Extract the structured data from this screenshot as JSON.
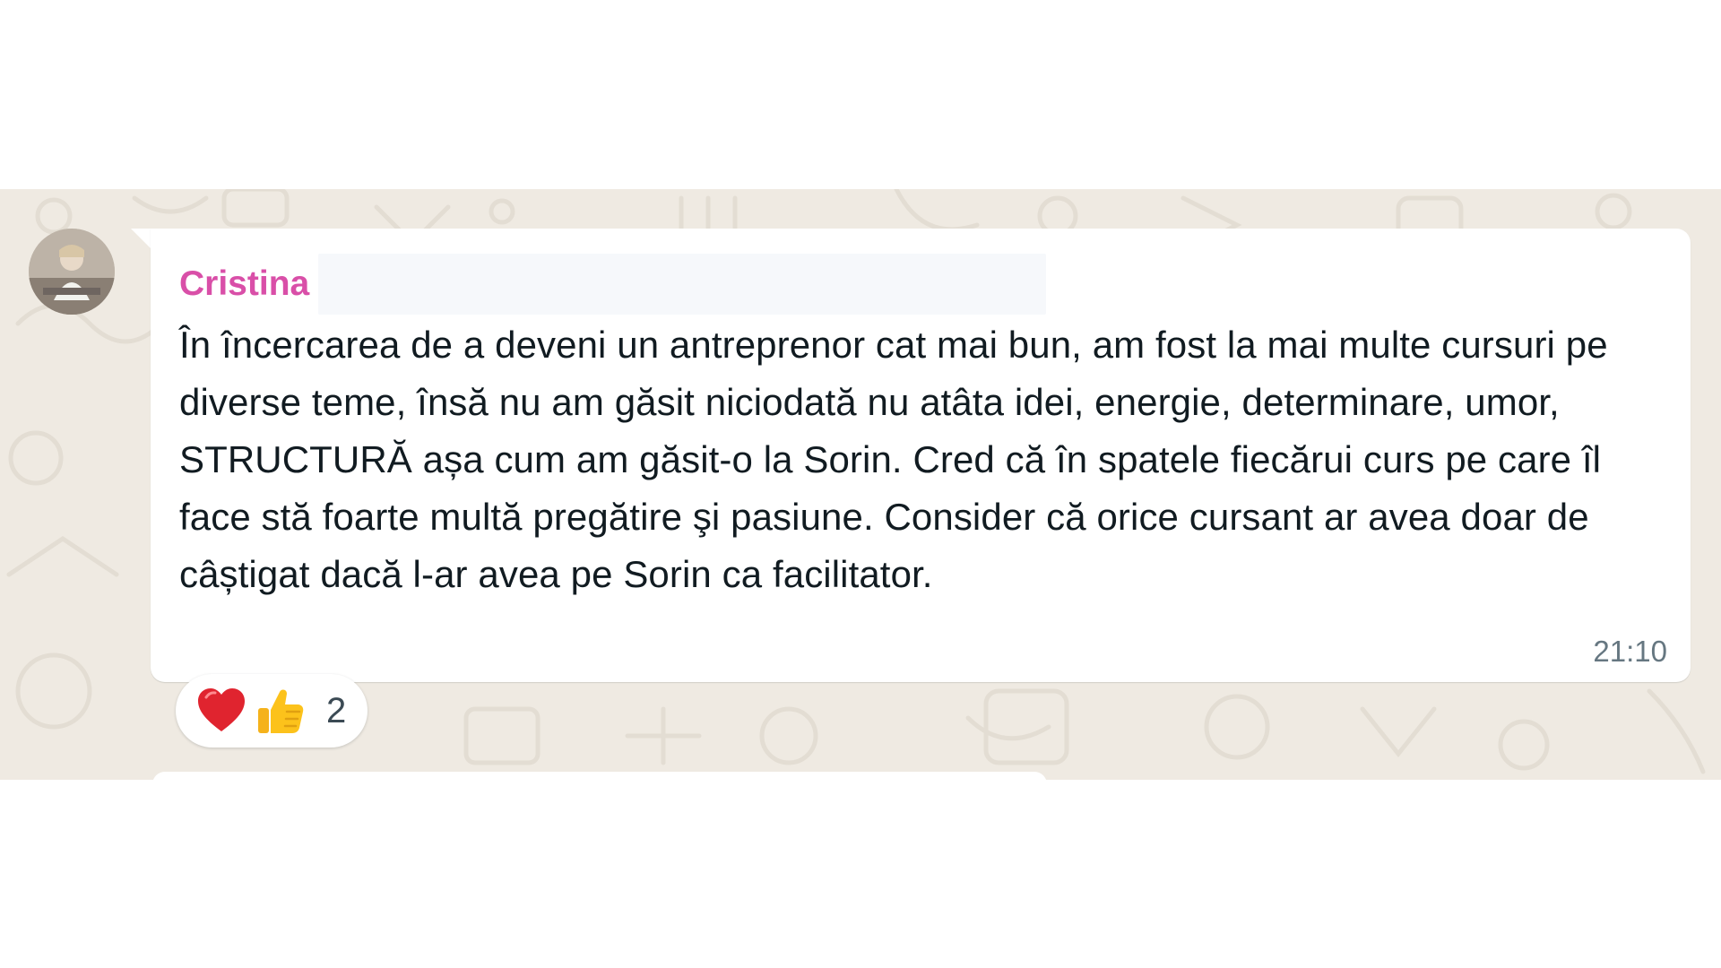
{
  "message": {
    "sender": "Cristina",
    "avatar_icon": "avatar-photo-icon",
    "text": "În încercarea de a deveni un antreprenor cat mai bun, am fost la mai multe cursuri pe diverse teme, însă nu am găsit niciodată nu atâta idei, energie, determinare, umor, STRUCTURĂ așa cum am găsit-o la Sorin. Cred că în spatele fiecărui curs pe care îl face stă foarte multă pregătire şi pasiune. Consider că orice cursant ar avea doar de câștigat dacă l-ar avea pe Sorin ca facilitator.",
    "time": "21:10"
  },
  "reactions": {
    "emojis": [
      "heart-emoji",
      "thumbs-up-emoji"
    ],
    "count": "2"
  },
  "colors": {
    "sender_name": "#d94fa8",
    "chat_background": "#efeae2",
    "bubble": "#ffffff",
    "timestamp": "#667781"
  }
}
